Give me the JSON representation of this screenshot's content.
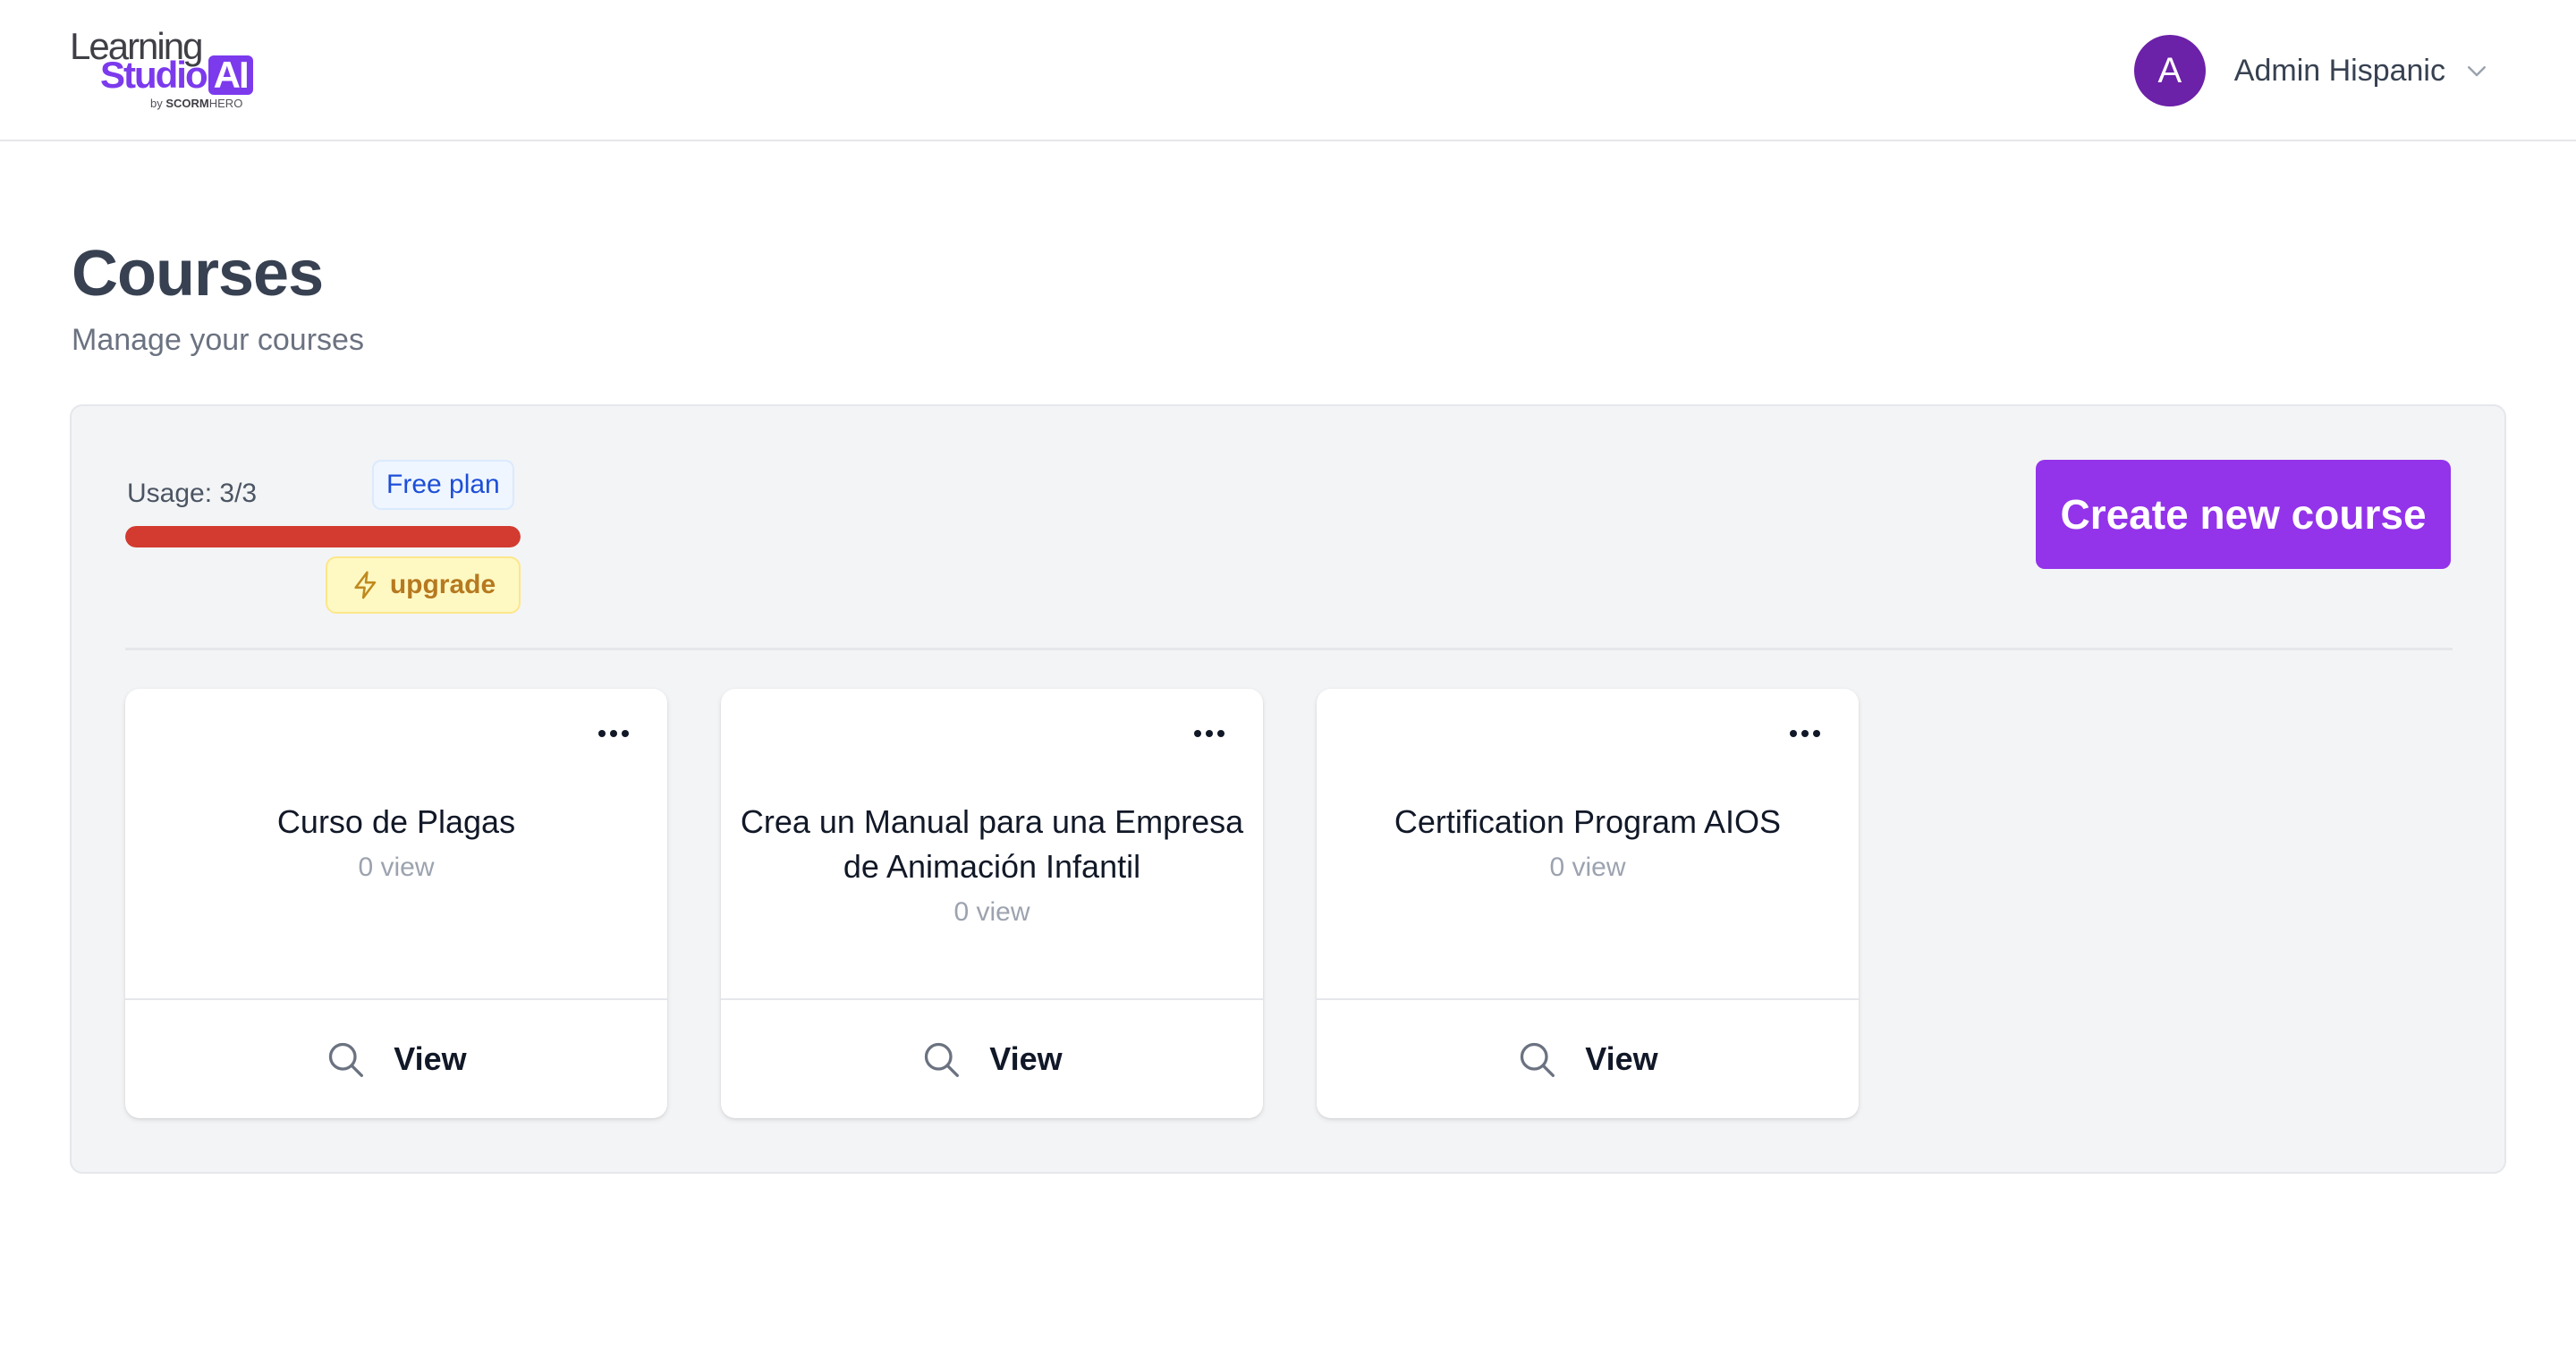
{
  "brand": {
    "line1": "Learning",
    "line2": "Studio",
    "line2_badge": "AI",
    "byline_prefix": "by",
    "byline_scorm": "SCORM",
    "byline_hero": "HERO",
    "color": "#7c3aed"
  },
  "user": {
    "avatar_initial": "A",
    "name": "Admin Hispanic",
    "avatar_color": "#6b21a8",
    "menu_icon": "chevron-down-icon"
  },
  "page": {
    "title": "Courses",
    "subtitle": "Manage your courses"
  },
  "usage": {
    "label": "Usage: 3/3",
    "used": 3,
    "limit": 3,
    "fill_fraction": 1.0,
    "bar_color": "#d33b30",
    "plan_badge": "Free plan",
    "upgrade_label": "upgrade",
    "upgrade_icon": "lightning-icon"
  },
  "actions": {
    "create_label": "Create new course",
    "accent_color": "#9333ea"
  },
  "courses": [
    {
      "title": "Curso de Plagas",
      "views": "0 view",
      "view_label": "View"
    },
    {
      "title": "Crea un Manual para una Empresa de Animación Infantil",
      "views": "0 view",
      "view_label": "View"
    },
    {
      "title": "Certification Program AIOS",
      "views": "0 view",
      "view_label": "View"
    }
  ]
}
